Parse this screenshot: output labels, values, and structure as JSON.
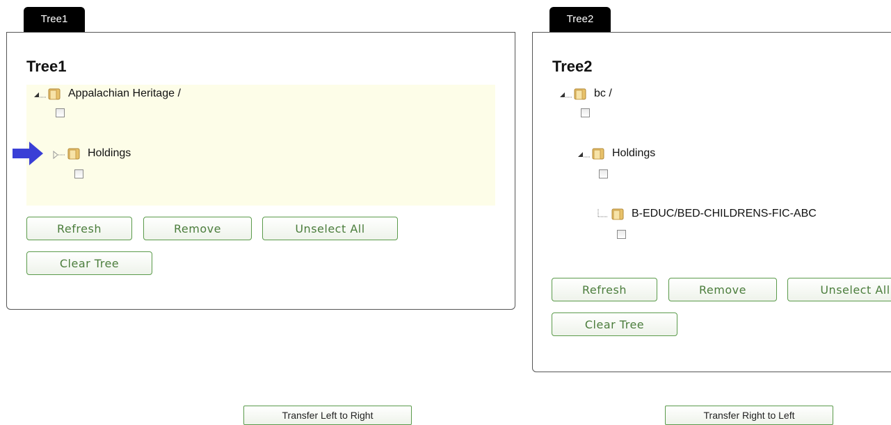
{
  "tree1": {
    "tab_label": "Tree1",
    "title": "Tree1",
    "nodes": [
      {
        "label": "Appalachian Heritage /"
      },
      {
        "label": "Holdings"
      }
    ],
    "buttons": {
      "refresh": "Refresh",
      "remove": "Remove",
      "unselect_all": "Unselect All",
      "clear_tree": "Clear Tree"
    }
  },
  "tree2": {
    "tab_label": "Tree2",
    "title": "Tree2",
    "nodes": [
      {
        "label": "bc /"
      },
      {
        "label": "Holdings"
      },
      {
        "label": "B-EDUC/BED-CHILDRENS-FIC-ABC"
      }
    ],
    "buttons": {
      "refresh": "Refresh",
      "remove": "Remove",
      "unselect_all": "Unselect All",
      "clear_tree": "Clear Tree"
    }
  },
  "transfer": {
    "left_to_right": "Transfer Left to Right",
    "right_to_left": "Transfer Right to Left"
  },
  "colors": {
    "button_text": "#4b7d3c",
    "button_border": "#5a9a4a",
    "highlight_bg": "#fdfde8",
    "pointer_arrow": "#3a3fd6"
  },
  "icons": {
    "folder": "folder-icon",
    "expander": "tree-expander-icon",
    "pointer": "pointer-arrow-icon"
  }
}
